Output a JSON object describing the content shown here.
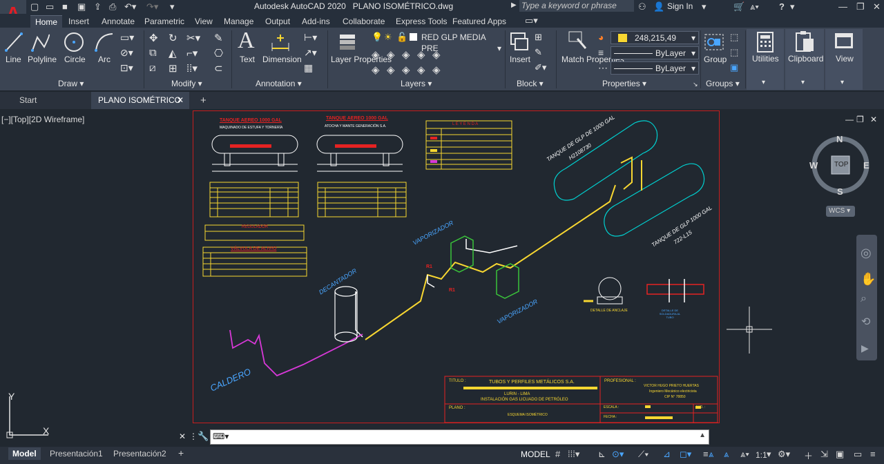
{
  "app": {
    "title": "Autodesk AutoCAD 2020",
    "document": "PLANO ISOMÉTRICO.dwg",
    "search_placeholder": "Type a keyword or phrase",
    "sign_in": "Sign In",
    "help": "?"
  },
  "ribbon_tabs": [
    "Home",
    "Insert",
    "Annotate",
    "Parametric",
    "View",
    "Manage",
    "Output",
    "Add-ins",
    "Collaborate",
    "Express Tools",
    "Featured Apps"
  ],
  "ribbon": {
    "draw": {
      "label": "Draw",
      "line": "Line",
      "polyline": "Polyline",
      "circle": "Circle",
      "arc": "Arc"
    },
    "modify": {
      "label": "Modify"
    },
    "annotation": {
      "label": "Annotation",
      "text": "Text",
      "dimension": "Dimension"
    },
    "layers": {
      "label": "Layers",
      "layer_properties": "Layer Properties",
      "current_layer": "RED GLP MEDIA PRE"
    },
    "block": {
      "label": "Block",
      "insert": "Insert"
    },
    "properties": {
      "label": "Properties",
      "match": "Match Properties",
      "color": "248,215,49",
      "linetype": "ByLayer",
      "lineweight": "ByLayer"
    },
    "groups": {
      "label": "Groups",
      "group": "Group"
    },
    "utilities": {
      "label": "Utilities"
    },
    "clipboard": {
      "label": "Clipboard"
    },
    "view": {
      "label": "View"
    }
  },
  "file_tabs": {
    "start": "Start",
    "active": "PLANO ISOMÉTRICO"
  },
  "viewport": {
    "label": "[−][Top][2D Wireframe]",
    "viewcube": {
      "n": "N",
      "s": "S",
      "e": "E",
      "w": "W",
      "top": "TOP",
      "wcs": "WCS"
    },
    "ucs": {
      "x": "X",
      "y": "Y"
    }
  },
  "drawing": {
    "tank1_title": "TANQUE AEREO 1000 GAL",
    "tank1_sub": "MAQUINADO DE ESTUFA Y TORNERÍA",
    "tank2_title": "TANQUE AEREO 1000 GAL",
    "tank2_sub": "ATOCHA Y MANTE GENERACIÓN S.A.",
    "legend_title": "L E Y E N D A",
    "regulador": "REGULADOR",
    "valvula": "VÁLVULA DE ALIVIO",
    "vaporizador1": "VAPORIZADOR",
    "vaporizador2": "VAPORIZADOR",
    "decantador": "DECANTADOR",
    "caldero": "CALDERO",
    "tanque_iso1": "TANQUE DE GLP DE 1000 GAL",
    "tanque_iso1_num": "H2108730",
    "tanque_iso2": "TANQUE DE GLP 1000 GAL",
    "tanque_iso2_num": "722-L15",
    "detalle_anclaje": "DETALLE DE ANCLAJE",
    "detalle_soldadura": "DETALLE DE SOLDADURA AL TUBO",
    "r1a": "R1",
    "r1b": "R1",
    "tb_titulo": "TITULO :",
    "tb_company": "TUBOS Y PERFILES METÁLICOS S.A.",
    "tb_location": "LURIN - LIMA",
    "tb_project": "INSTALACIÓN GAS LICUADO DE PETRÓLEO",
    "tb_plano": "PLANO :",
    "tb_plano_val": "ESQUEMA ISOMÉTRICO",
    "tb_profesional": "PROFESIONAL :",
    "tb_name": "VICTOR HUGO PRIETO HUERTAS",
    "tb_role": "Ingeniero Mecánico electricista",
    "tb_cip": "CIP N° 78850",
    "tb_escala": "ESCALA :",
    "tb_fecha": "FECHA :",
    "tb_nro": "N°D. :"
  },
  "status": {
    "tabs": [
      "Model",
      "Presentación1",
      "Presentación2"
    ],
    "model_btn": "MODEL",
    "scale": "1:1"
  },
  "colors": {
    "accent_red": "#e01e26",
    "ribbon_bg": "#3b4453",
    "canvas": "#212830",
    "color_swatch": "#f8d731"
  }
}
